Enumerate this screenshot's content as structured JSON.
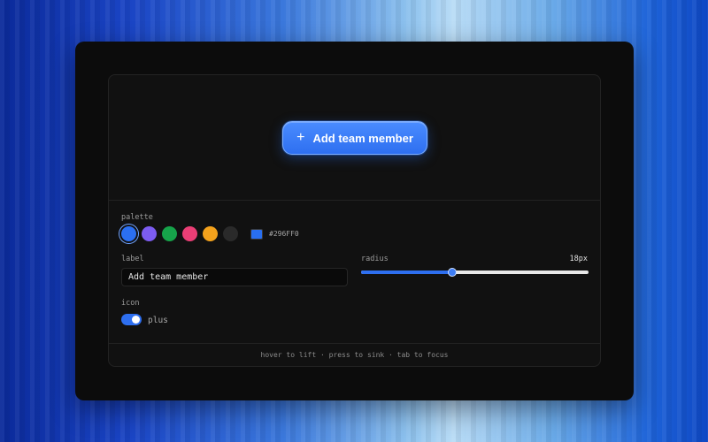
{
  "preview": {
    "button_label": "Add team member",
    "button_icon": "plus-icon",
    "button_color": "#296FF0"
  },
  "palette": {
    "label": "palette",
    "swatches": [
      {
        "name": "blue",
        "color": "#2b6ff2",
        "selected": true
      },
      {
        "name": "purple",
        "color": "#7c5cf0",
        "selected": false
      },
      {
        "name": "green",
        "color": "#16a34a",
        "selected": false
      },
      {
        "name": "pink",
        "color": "#ea3e75",
        "selected": false
      },
      {
        "name": "amber",
        "color": "#f4a21c",
        "selected": false
      },
      {
        "name": "dark",
        "color": "#2a2a2a",
        "selected": false
      }
    ],
    "hex_value": "#296FF0"
  },
  "label_field": {
    "label": "label",
    "value": "Add team member"
  },
  "radius": {
    "label": "radius",
    "value_text": "18px",
    "fraction": 0.4
  },
  "icon": {
    "label": "icon",
    "toggle_on": true,
    "value": "plus"
  },
  "footer": {
    "hint": "hover to lift · press to sink · tab to focus"
  }
}
